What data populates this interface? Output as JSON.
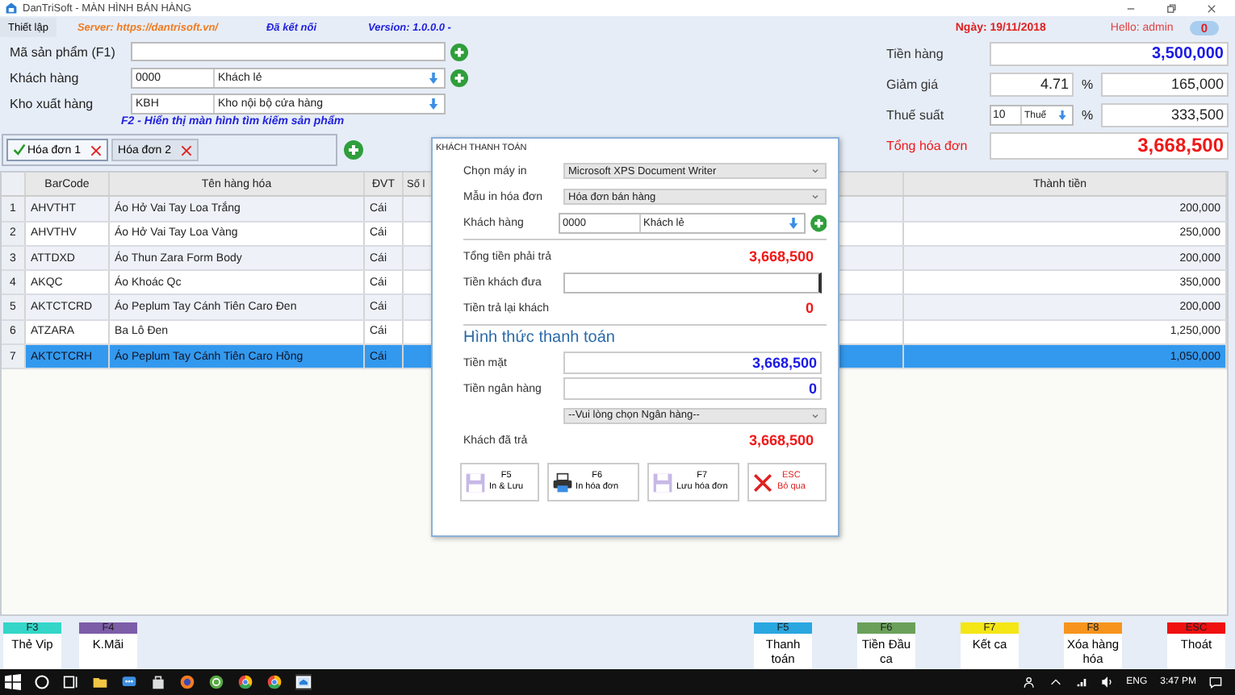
{
  "window": {
    "title": "DanTriSoft - MÀN HÌNH BÁN HÀNG"
  },
  "topbar": {
    "settings": "Thiết lập",
    "server": "Server: https://dantrisoft.vn/",
    "connection": "Đã kết nối",
    "version": "Version: 1.0.0.0 -",
    "date": "Ngày: 19/11/2018",
    "greeting": "Hello: admin",
    "notifications": "0"
  },
  "form": {
    "product_label": "Mã sản phẩm (F1)",
    "customer_label": "Khách hàng",
    "customer_code": "0000",
    "customer_name": "Khách lẻ",
    "warehouse_label": "Kho xuất hàng",
    "warehouse_code": "KBH",
    "warehouse_name": "Kho nội bộ cửa hàng",
    "hint": "F2 - Hiển thị màn hình tìm kiếm sản phẩm"
  },
  "invoice_tabs": [
    {
      "label": "Hóa đơn 1",
      "selected": true
    },
    {
      "label": "Hóa đơn 2",
      "selected": false
    }
  ],
  "summary": {
    "subtotal_label": "Tiền hàng",
    "subtotal": "3,500,000",
    "discount_label": "Giảm giá",
    "discount_rate": "4.71",
    "discount_unit": "%",
    "discount": "165,000",
    "tax_label": "Thuế suất",
    "tax_rate": "10",
    "tax_type": "Thuế",
    "tax_unit": "%",
    "tax": "333,500",
    "total_label": "Tổng hóa đơn",
    "total": "3,668,500"
  },
  "table": {
    "columns": [
      "BarCode",
      "Tên hàng hóa",
      "ĐVT",
      "Số l",
      "Thành tiền"
    ],
    "rows": [
      {
        "index": "1",
        "barcode": "AHVTHT",
        "name": "Áo Hở Vai Tay Loa Trắng",
        "unit": "Cái",
        "amount": "200,000",
        "selected": false
      },
      {
        "index": "2",
        "barcode": "AHVTHV",
        "name": "Áo Hở Vai Tay Loa Vàng",
        "unit": "Cái",
        "amount": "250,000",
        "selected": false
      },
      {
        "index": "3",
        "barcode": "ATTDXD",
        "name": "Áo Thun Zara Form Body",
        "unit": "Cái",
        "amount": "200,000",
        "selected": false
      },
      {
        "index": "4",
        "barcode": "AKQC",
        "name": "Áo Khoác Qc",
        "unit": "Cái",
        "amount": "350,000",
        "selected": false
      },
      {
        "index": "5",
        "barcode": "AKTCTCRD",
        "name": "Áo Peplum Tay Cánh Tiên Caro Đen",
        "unit": "Cái",
        "amount": "200,000",
        "selected": false
      },
      {
        "index": "6",
        "barcode": "ATZARA",
        "name": "Ba Lô Đen",
        "unit": "Cái",
        "amount": "1,250,000",
        "selected": false
      },
      {
        "index": "7",
        "barcode": "AKTCTCRH",
        "name": "Áo Peplum Tay Cánh Tiên Caro Hồng",
        "unit": "Cái",
        "amount": "1,050,000",
        "selected": true
      }
    ]
  },
  "dialog": {
    "title": "KHÁCH THANH TOÁN",
    "printer_label": "Chọn máy in",
    "printer": "Microsoft XPS Document Writer",
    "template_label": "Mẫu in hóa đơn",
    "template": "Hóa đơn bán hàng",
    "customer_label": "Khách hàng",
    "customer_code": "0000",
    "customer_name": "Khách lẻ",
    "total_label": "Tổng tiền phải trả",
    "total": "3,668,500",
    "given_label": "Tiền khách đưa",
    "change_label": "Tiền trả lại khách",
    "change": "0",
    "method_heading": "Hình thức thanh toán",
    "cash_label": "Tiền mặt",
    "cash": "3,668,500",
    "bank_label": "Tiền ngân hàng",
    "bank": "0",
    "bank_select": "--Vui lòng chọn Ngân hàng--",
    "paid_label": "Khách đã trả",
    "paid": "3,668,500",
    "buttons": [
      {
        "key": "F5",
        "label": "In & Lưu",
        "kind": "save"
      },
      {
        "key": "F6",
        "label": "In hóa đơn",
        "kind": "print"
      },
      {
        "key": "F7",
        "label": "Lưu hóa đơn",
        "kind": "save"
      },
      {
        "key": "ESC",
        "label": "Bỏ qua",
        "kind": "cancel"
      }
    ]
  },
  "function_keys_left": [
    {
      "key": "F3",
      "label": "Thẻ Vip",
      "color": "#33d6c8"
    },
    {
      "key": "F4",
      "label": "K.Mãi",
      "color": "#7d5ca8"
    }
  ],
  "function_keys_right": [
    {
      "key": "F5",
      "label": "Thanh toán",
      "color": "#2aa6e0"
    },
    {
      "key": "F6",
      "label": "Tiền Đầu ca",
      "color": "#6aa05a"
    },
    {
      "key": "F7",
      "label": "Kết ca",
      "color": "#f5e616"
    },
    {
      "key": "F8",
      "label": "Xóa hàng hóa",
      "color": "#f7941d"
    },
    {
      "key": "ESC",
      "label": "Thoát",
      "color": "#f01010"
    }
  ],
  "taskbar": {
    "language": "ENG",
    "time": "3:47 PM"
  }
}
